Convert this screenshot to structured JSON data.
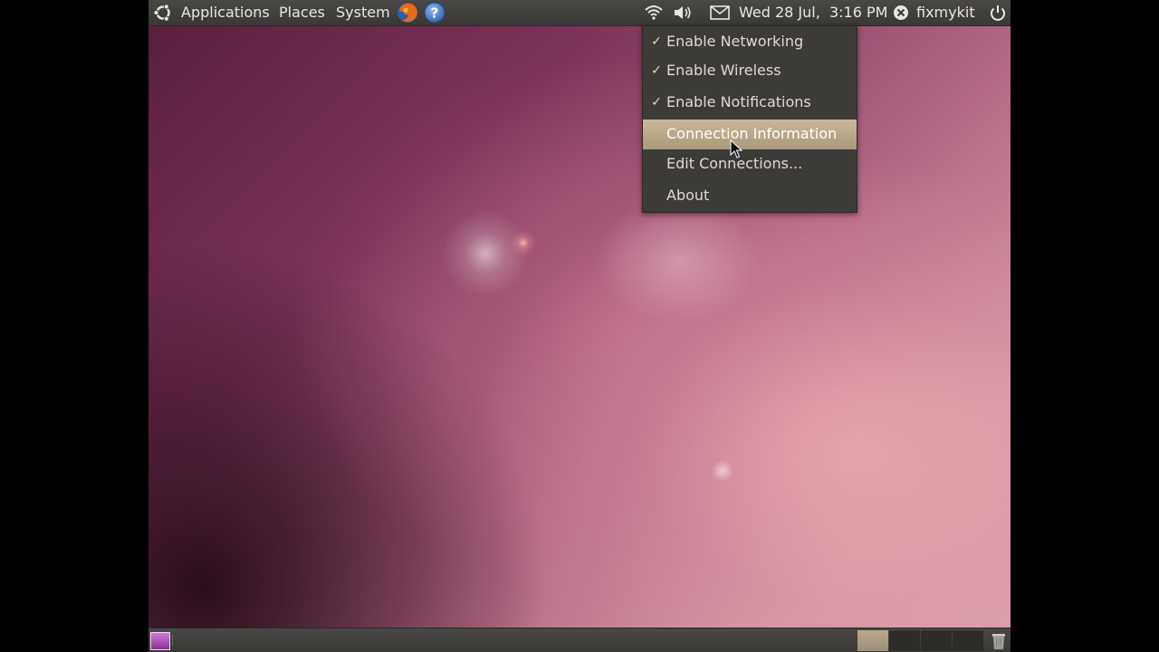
{
  "top_panel": {
    "menus": {
      "applications": "Applications",
      "places": "Places",
      "system": "System"
    },
    "launchers": [
      "firefox-icon",
      "help-icon"
    ],
    "clock": "Wed 28 Jul,  3:16 PM",
    "username": "fixmykit",
    "tray_icons": [
      "wifi-icon",
      "volume-icon",
      "mail-icon",
      "user-status-icon",
      "power-icon"
    ]
  },
  "network_menu": {
    "items": [
      {
        "label": "Enable Networking",
        "checked": true
      },
      {
        "label": "Enable Wireless",
        "checked": true
      },
      {
        "label": "Enable Notifications",
        "checked": true
      },
      {
        "label": "Connection Information",
        "checked": false,
        "highlighted": true
      },
      {
        "label": "Edit Connections...",
        "checked": false
      },
      {
        "label": "About",
        "checked": false
      }
    ],
    "check_glyph": "✓"
  },
  "colors": {
    "panel": "#3c3b37",
    "highlight": "#b9a98a",
    "menu_text": "#dfdbd2"
  }
}
